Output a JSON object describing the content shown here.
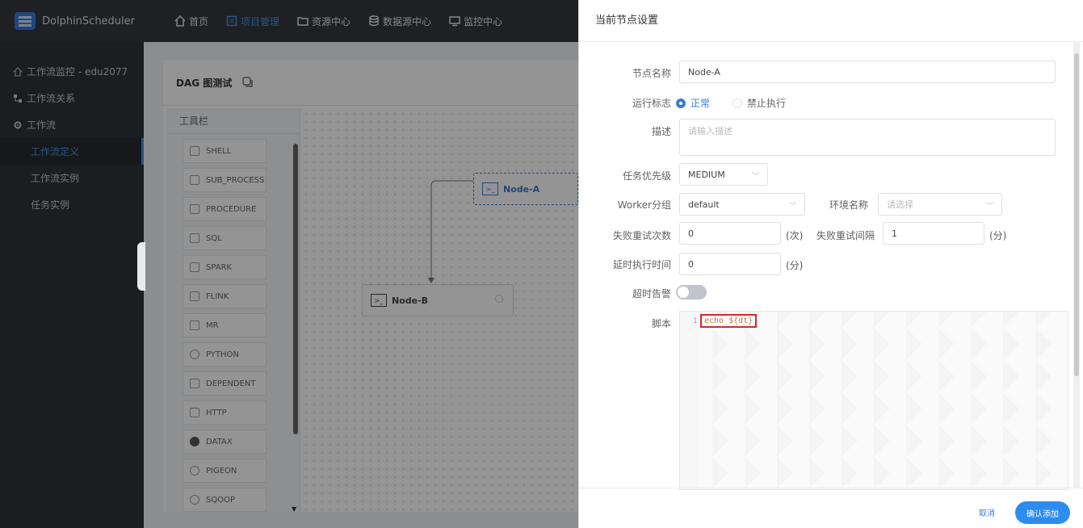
{
  "app": {
    "name": "DolphinScheduler"
  },
  "nav": [
    {
      "label": "首页",
      "icon": "home-icon"
    },
    {
      "label": "项目管理",
      "icon": "project-icon",
      "active": true
    },
    {
      "label": "资源中心",
      "icon": "folder-icon"
    },
    {
      "label": "数据源中心",
      "icon": "database-icon"
    },
    {
      "label": "监控中心",
      "icon": "monitor-icon"
    }
  ],
  "sidebar": {
    "items": [
      {
        "label": "工作流监控 - edu2077"
      },
      {
        "label": "工作流关系"
      },
      {
        "label": "工作流"
      }
    ],
    "sub": [
      {
        "label": "工作流定义",
        "active": true
      },
      {
        "label": "工作流实例"
      },
      {
        "label": "任务实例"
      }
    ]
  },
  "dag": {
    "title": "DAG 图测试",
    "toolbar_title": "工具栏",
    "tools": [
      "SHELL",
      "SUB_PROCESS",
      "PROCEDURE",
      "SQL",
      "SPARK",
      "FLINK",
      "MR",
      "PYTHON",
      "DEPENDENT",
      "HTTP",
      "DATAX",
      "PIGEON",
      "SQOOP"
    ],
    "nodes": {
      "a": "Node-A",
      "b": "Node-B"
    }
  },
  "drawer": {
    "title": "当前节点设置",
    "node_name_label": "节点名称",
    "node_name": "Node-A",
    "run_flag_label": "运行标志",
    "run_flag_normal": "正常",
    "run_flag_forbid": "禁止执行",
    "desc_label": "描述",
    "desc_placeholder": "请输入描述",
    "priority_label": "任务优先级",
    "priority": "MEDIUM",
    "worker_label": "Worker分组",
    "worker": "default",
    "env_label": "环境名称",
    "env_placeholder": "请选择",
    "retry_times_label": "失败重试次数",
    "retry_times": "0",
    "retry_times_unit": "(次)",
    "retry_interval_label": "失败重试间隔",
    "retry_interval": "1",
    "retry_interval_unit": "(分)",
    "delay_label": "延时执行时间",
    "delay": "0",
    "delay_unit": "(分)",
    "timeout_label": "超时告警",
    "script_label": "脚本",
    "script_line_no": "1",
    "script_code": "echo ${dt}",
    "cancel": "取消",
    "confirm": "确认添加"
  },
  "colors": {
    "accent": "#2d8cf0",
    "topbar": "#34383f",
    "sidebar": "#2f3238",
    "highlight": "#d9262c"
  }
}
